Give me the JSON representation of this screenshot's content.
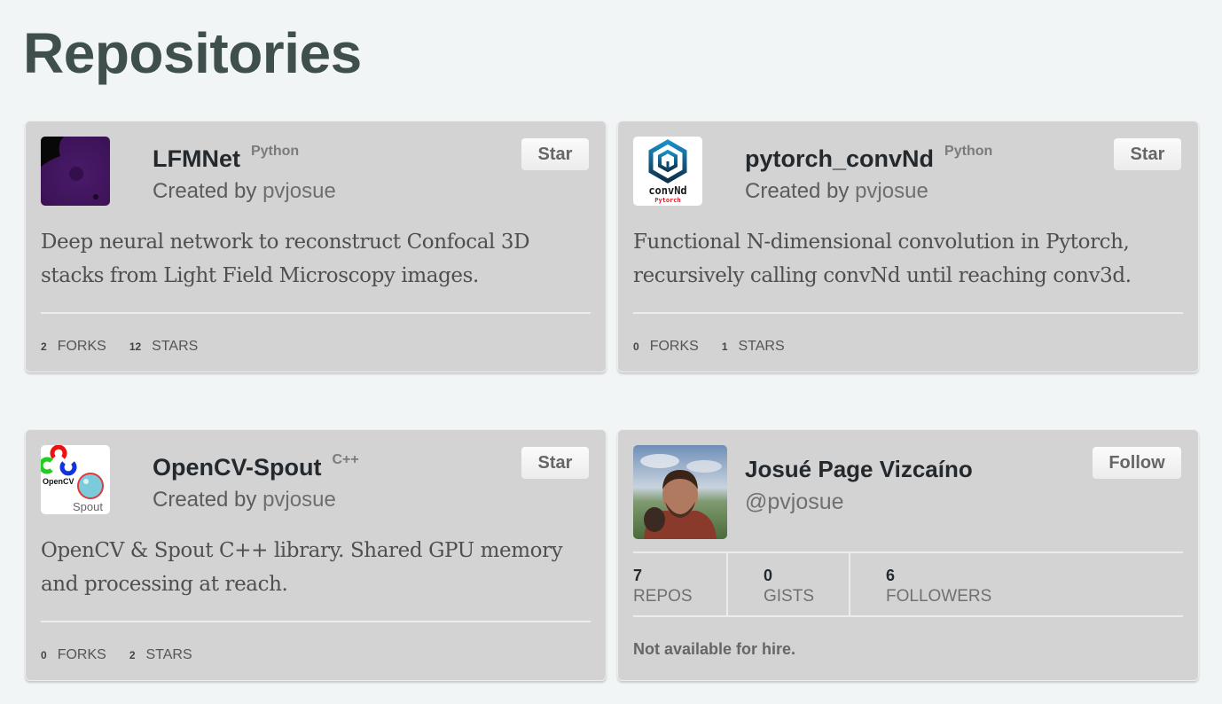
{
  "page": {
    "title": "Repositories"
  },
  "repos": [
    {
      "name": "LFMNet",
      "language": "Python",
      "created_prefix": "Created by ",
      "owner": "pvjosue",
      "star_label": "Star",
      "description": "Deep neural network to reconstruct Confocal 3D stacks from Light Field Microscopy images.",
      "forks": "2",
      "forks_label": "FORKS",
      "stars": "12",
      "stars_label": "STARS",
      "avatar_icon": "microscopy-image-icon"
    },
    {
      "name": "pytorch_convNd",
      "language": "Python",
      "created_prefix": "Created by ",
      "owner": "pvjosue",
      "star_label": "Star",
      "description": "Functional N-dimensional convolution in Pytorch, recursively calling convNd until reaching conv3d.",
      "forks": "0",
      "forks_label": "FORKS",
      "stars": "1",
      "stars_label": "STARS",
      "avatar_icon": "convnd-logo-icon",
      "logo_text": "convNd",
      "logo_subtext": "Pytorch"
    },
    {
      "name": "OpenCV-Spout",
      "language": "C++",
      "created_prefix": "Created by ",
      "owner": "pvjosue",
      "star_label": "Star",
      "description": "OpenCV & Spout C++ library. Shared GPU memory and processing at reach.",
      "forks": "0",
      "forks_label": "FORKS",
      "stars": "2",
      "stars_label": "STARS",
      "avatar_icon": "opencv-spout-logo-icon",
      "logo_text": "OpenCV",
      "logo_subtext": "Spout"
    }
  ],
  "profile": {
    "name": "Josué Page Vizcaíno",
    "handle": "@pvjosue",
    "follow_label": "Follow",
    "stats": [
      {
        "value": "7",
        "label": "REPOS"
      },
      {
        "value": "0",
        "label": "GISTS"
      },
      {
        "value": "6",
        "label": "FOLLOWERS"
      }
    ],
    "hire_status": "Not available for hire."
  },
  "colors": {
    "background": "#f1f5f6",
    "card": "#d3d3d3",
    "title": "#3e4f4c"
  }
}
